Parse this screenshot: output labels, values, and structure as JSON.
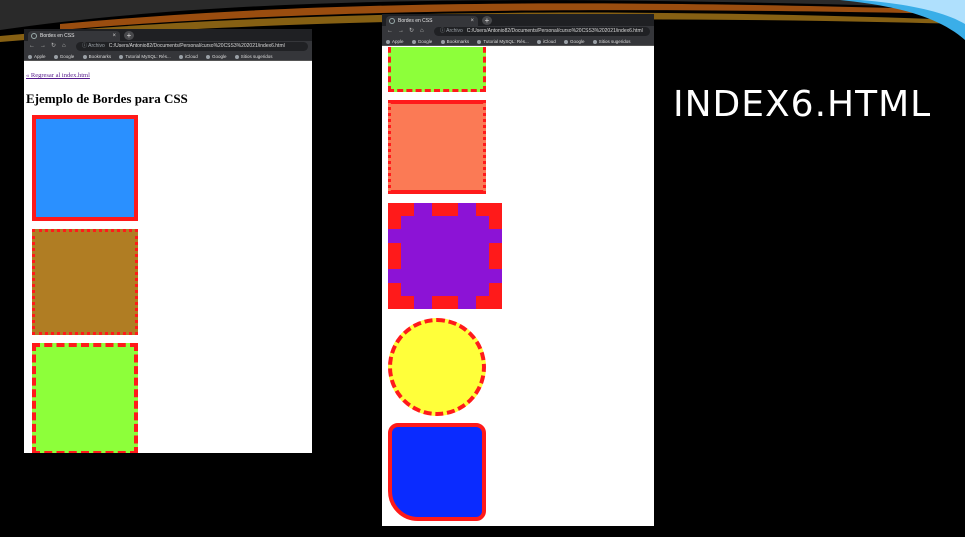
{
  "slide": {
    "title": "INDEX6.HTML"
  },
  "browser": {
    "tab_title": "Bordes en CSS",
    "tab_close": "×",
    "new_tab": "+",
    "nav_icons": [
      "back-icon",
      "forward-icon",
      "reload-icon",
      "home-icon"
    ],
    "address_scheme": "ⓘ Archivo",
    "address_url": "C:/Users/Antonio82/Documents/Personal/curso%20CSS3%202021/index6.html",
    "bookmarks": [
      "Apple",
      "Google",
      "Bookmarks",
      "Tutorial MySQL: Rés...",
      "iCloud",
      "Google",
      "Sitios sugeridos"
    ]
  },
  "page": {
    "back_link": "« Regresar al index.html",
    "heading": "Ejemplo de Bordes para CSS"
  },
  "boxes": {
    "blue_solid": {
      "fill": "#2a90ff",
      "border": "#ff1a1a",
      "style": "solid"
    },
    "brown_dotted": {
      "fill": "#b07d23",
      "border": "#ff1a1a",
      "style": "dotted"
    },
    "green_dashed": {
      "fill": "#8dff3a",
      "border": "#ff1a1a",
      "style": "dashed"
    },
    "salmon_mixed": {
      "fill": "#fb7a55",
      "border": "#ff1a1a",
      "style": "mixed"
    },
    "purple_thick_dashed": {
      "fill": "#8c13d6",
      "border": "#ff1a1a",
      "style": "dashed"
    },
    "yellow_circle": {
      "fill": "#ffff3a",
      "border": "#ff1a1a",
      "style": "dashed"
    },
    "blue_rounded": {
      "fill": "#0a2bff",
      "border": "#ff1a1a",
      "style": "solid"
    }
  }
}
